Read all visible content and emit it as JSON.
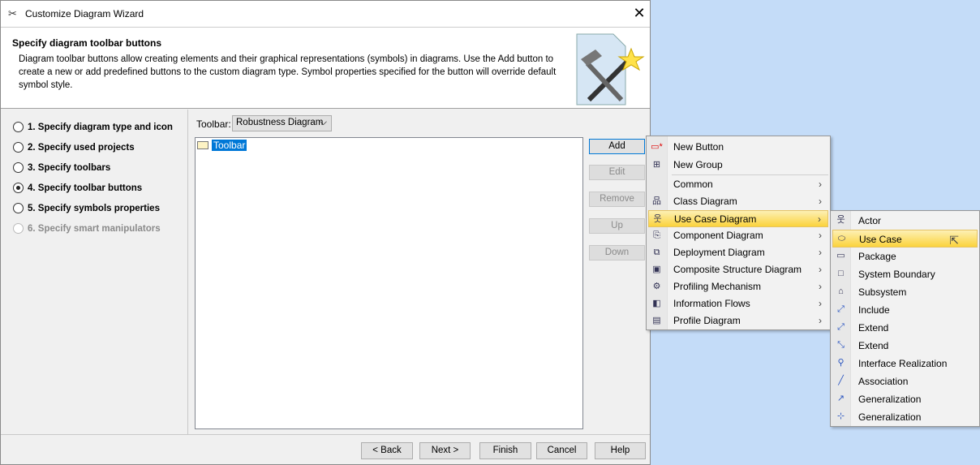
{
  "window": {
    "title": "Customize Diagram Wizard",
    "close": "✕"
  },
  "header": {
    "title": "Specify diagram toolbar buttons",
    "description": "Diagram toolbar buttons allow creating elements and their graphical representations (symbols) in diagrams. Use the Add button to create a new or add predefined buttons to the custom diagram type. Symbol properties specified for the button will override default symbol style."
  },
  "steps": [
    {
      "label": "1. Specify diagram type and icon",
      "selected": false,
      "enabled": true
    },
    {
      "label": "2. Specify used projects",
      "selected": false,
      "enabled": true
    },
    {
      "label": "3. Specify toolbars",
      "selected": false,
      "enabled": true
    },
    {
      "label": "4. Specify toolbar buttons",
      "selected": true,
      "enabled": true
    },
    {
      "label": "5. Specify symbols properties",
      "selected": false,
      "enabled": true
    },
    {
      "label": "6. Specify smart manipulators",
      "selected": false,
      "enabled": false
    }
  ],
  "toolbar": {
    "label": "Toolbar:",
    "selected": "Robustness Diagram",
    "tree_root": "Toolbar"
  },
  "side_buttons": {
    "add": "Add",
    "edit": "Edit",
    "remove": "Remove",
    "up": "Up",
    "down": "Down"
  },
  "footer": {
    "back": "< Back",
    "next": "Next >",
    "finish": "Finish",
    "cancel": "Cancel",
    "help": "Help"
  },
  "menu": {
    "items": [
      "New Button",
      "New Group",
      "Common",
      "Class Diagram",
      "Use Case Diagram",
      "Component Diagram",
      "Deployment Diagram",
      "Composite Structure Diagram",
      "Profiling Mechanism",
      "Information Flows",
      "Profile Diagram"
    ]
  },
  "submenu": {
    "items": [
      "Actor",
      "Use Case",
      "Package",
      "System Boundary",
      "Subsystem",
      "Include",
      "Extend",
      "Extend",
      "Interface Realization",
      "Association",
      "Generalization",
      "Generalization"
    ]
  }
}
